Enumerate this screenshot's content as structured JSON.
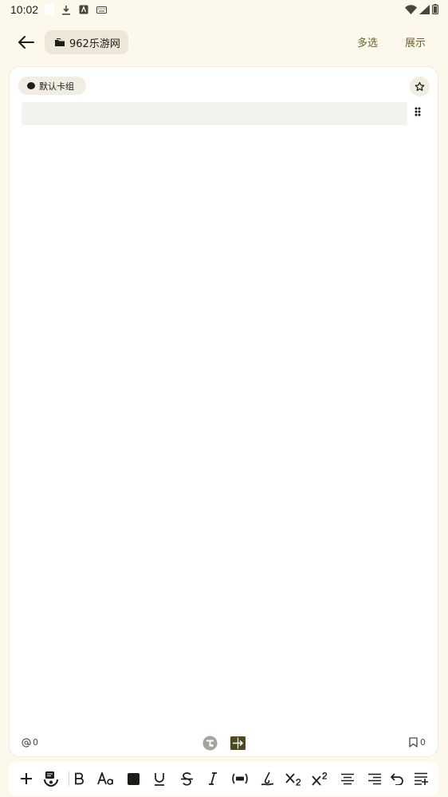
{
  "status_bar": {
    "time": "10:02",
    "left_icons": [
      "download-icon",
      "a-box-icon",
      "keyboard-icon"
    ],
    "right_icons": [
      "wifi-icon",
      "signal-icon",
      "battery-icon"
    ]
  },
  "header": {
    "folder_name": "962乐游网",
    "multi_select_label": "多选",
    "display_label": "展示"
  },
  "card": {
    "group_label": "默认卡组",
    "text_value": "",
    "mention_count": "0",
    "bookmark_count": "0"
  },
  "toolbar": {
    "icons": [
      "plus-icon",
      "template-icon",
      "bold-icon",
      "font-size-icon",
      "text-color-icon",
      "underline-icon",
      "strikethrough-icon",
      "italic-icon",
      "cloze-icon",
      "highlight-icon",
      "subscript-icon",
      "superscript-icon",
      "align-center-icon",
      "align-right-icon",
      "undo-icon",
      "more-format-icon"
    ]
  },
  "colors": {
    "background": "#fcf8ec",
    "accent_text": "#6a6531",
    "chip": "#ece7d8",
    "card": "#ffffff"
  }
}
